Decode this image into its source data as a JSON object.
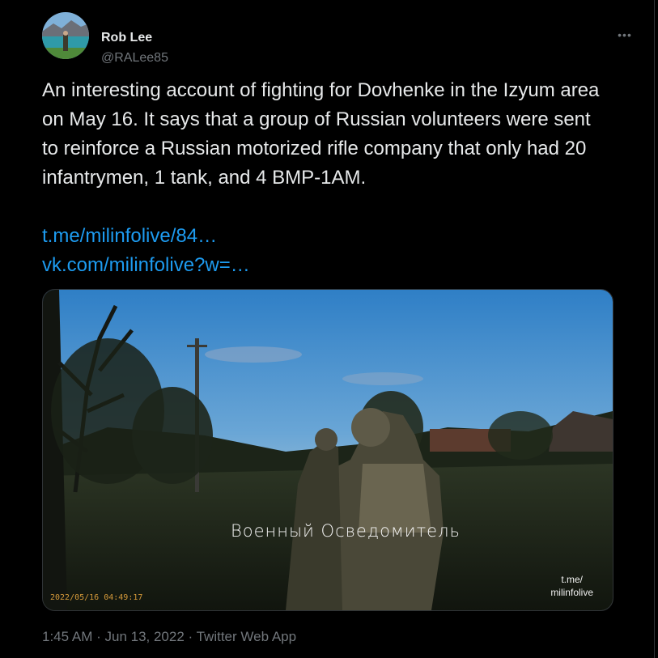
{
  "tweet": {
    "author_name": "Rob Lee",
    "author_handle": "@RALee85",
    "more_icon": "more-horizontal-icon",
    "text": "An interesting account of fighting for Dovhenke in the Izyum area on May 16. It says that a group of Russian volunteers were sent to reinforce a Russian motorized rifle company that only had 20 infantrymen, 1 tank, and 4 BMP-1AM.",
    "links": [
      "t.me/milinfolive/84…",
      "vk.com/milinfolive?w=…"
    ],
    "media": {
      "watermark": "Военный Осведомитель",
      "channel_line1": "t.me/",
      "channel_line2": "milinfolive",
      "timestamp_overlay": "2022/05/16  04:49:17"
    },
    "time": "1:45 AM",
    "separator": " · ",
    "date": "Jun 13, 2022",
    "source": "Twitter Web App"
  },
  "colors": {
    "background": "#000000",
    "text": "#e7e9ea",
    "secondary": "#71767b",
    "link": "#1d9bf0",
    "border": "#2f3336"
  }
}
